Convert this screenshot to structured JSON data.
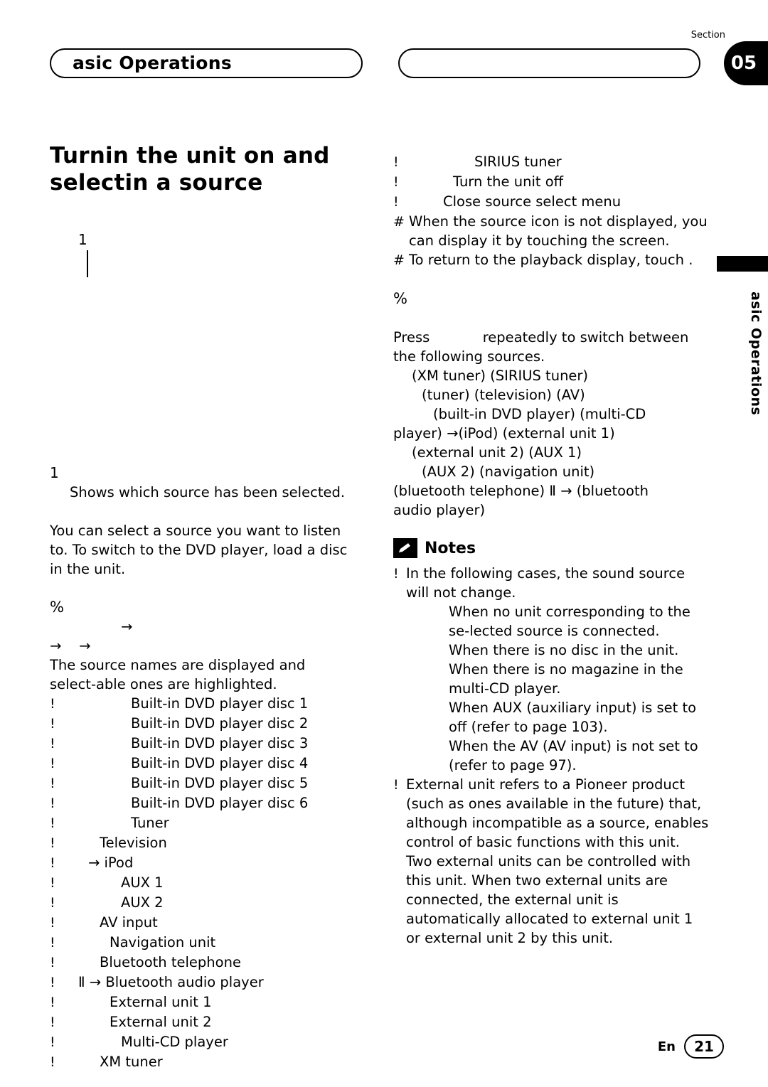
{
  "header": {
    "title": "asic Operations",
    "section_label": "Section",
    "section_number": "05"
  },
  "side_tab": {
    "text": "asic Operations"
  },
  "left_column": {
    "title": "Turnin  the unit on and selectin  a source",
    "callout_number": "1",
    "step_number": "1",
    "step_text": "Shows which source has been selected.",
    "paragraph": "You can select a source you want to listen to. To switch to the DVD player, load a disc in the unit.",
    "percent_marker": "%",
    "arrow_line_1": "→",
    "arrow_line_2": "→",
    "arrow_line_3": "→",
    "source_intro": "The source names are displayed and select-able ones are highlighted.",
    "source_list": [
      {
        "bullet": "!",
        "pad": "pad-100",
        "label": "Built-in DVD player disc 1"
      },
      {
        "bullet": "!",
        "pad": "pad-100",
        "label": "Built-in DVD player disc 2"
      },
      {
        "bullet": "!",
        "pad": "pad-100",
        "label": "Built-in DVD player disc 3"
      },
      {
        "bullet": "!",
        "pad": "pad-100",
        "label": "Built-in DVD player disc 4"
      },
      {
        "bullet": "!",
        "pad": "pad-100",
        "label": "Built-in DVD player disc 5"
      },
      {
        "bullet": "!",
        "pad": "pad-100",
        "label": "Built-in DVD player disc 6"
      },
      {
        "bullet": "!",
        "pad": "pad-100",
        "label": "Tuner"
      },
      {
        "bullet": "!",
        "pad": "pad-56",
        "label": "Television"
      },
      {
        "bullet": "!",
        "pad": "pad-40",
        "label": "→ iPod"
      },
      {
        "bullet": "!",
        "pad": "pad-86",
        "label": "AUX 1"
      },
      {
        "bullet": "!",
        "pad": "pad-86",
        "label": "AUX 2"
      },
      {
        "bullet": "!",
        "pad": "pad-56",
        "label": "AV input"
      },
      {
        "bullet": "!",
        "pad": "pad-70",
        "label": "Navigation unit"
      },
      {
        "bullet": "!",
        "pad": "pad-56",
        "label": "Bluetooth telephone"
      },
      {
        "bullet": "!",
        "pad": "pad-26",
        "label": "Ⅱ     →     Bluetooth audio player"
      },
      {
        "bullet": "!",
        "pad": "pad-70",
        "label": "External unit 1"
      },
      {
        "bullet": "!",
        "pad": "pad-70",
        "label": "External unit 2"
      },
      {
        "bullet": "!",
        "pad": "pad-86",
        "label": "Multi-CD player"
      },
      {
        "bullet": "!",
        "pad": "pad-56",
        "label": "XM tuner"
      }
    ]
  },
  "right_column": {
    "top_list": [
      {
        "bullet": "!",
        "pad": "pad-100",
        "label": "SIRIUS tuner"
      },
      {
        "bullet": "!",
        "pad": "pad-70",
        "label": "Turn the unit off"
      },
      {
        "bullet": "!",
        "pad": "pad-56",
        "label": "Close source select menu"
      }
    ],
    "hash_notes": [
      "When the source icon is not displayed, you can display it by touching the screen.",
      "To return to the playback display, touch      ."
    ],
    "percent_marker": "%",
    "press_text_1": "Press",
    "press_text_2": "repeatedly to switch between the following sources.",
    "source_cycle": [
      {
        "pad": "pad-26",
        "text": "(XM tuner)                (SIRIUS tuner)"
      },
      {
        "pad": "pad-40",
        "text": "(tuner)         (television)            (AV)"
      },
      {
        "pad": "pad-56",
        "text": "(built-in DVD player)                (multi-CD"
      },
      {
        "pad": "",
        "text": "player)        →(iPod)              (external unit 1)"
      },
      {
        "pad": "pad-26",
        "text": "(external unit 2)              (AUX 1)"
      },
      {
        "pad": "pad-40",
        "text": "(AUX 2)              (navigation unit)"
      },
      {
        "pad": "",
        "text": "(bluetooth telephone)    Ⅱ      →   (bluetooth"
      },
      {
        "pad": "",
        "text": "audio player)"
      }
    ],
    "notes_title": "Notes",
    "notes": [
      {
        "bullet": "!",
        "text": "In the following cases, the sound source will not change.",
        "subitems": [
          "When no unit corresponding to the se-lected source is connected.",
          "When there is no disc in the unit.",
          "When there is no magazine in the multi-CD player.",
          "When AUX (auxiliary input) is set to off (refer to page 103).",
          "When the AV (AV input) is not set to         (refer to page 97)."
        ]
      },
      {
        "bullet": "!",
        "text": "External unit refers to a Pioneer product (such as ones available in the future) that, although incompatible as a source, enables control of basic functions with this unit. Two external units can be controlled with this unit. When two external units are connected, the external unit is automatically allocated to external unit 1 or external unit 2 by this unit.",
        "subitems": []
      }
    ]
  },
  "footer": {
    "language": "En",
    "page_number": "21"
  }
}
